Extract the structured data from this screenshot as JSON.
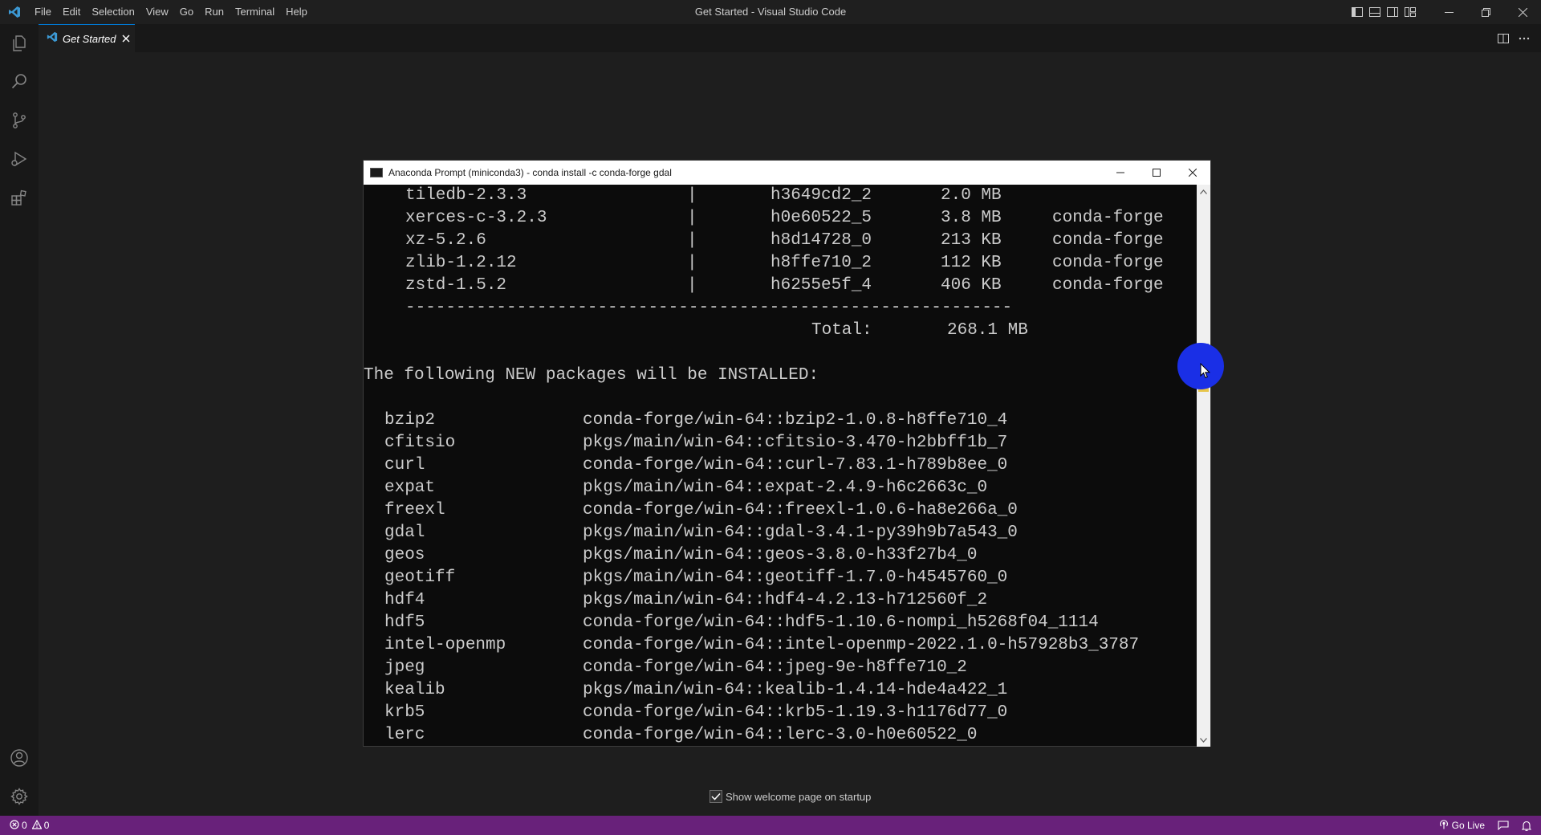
{
  "window": {
    "title": "Get Started - Visual Studio Code"
  },
  "menu": [
    "File",
    "Edit",
    "Selection",
    "View",
    "Go",
    "Run",
    "Terminal",
    "Help"
  ],
  "activity_icons": [
    "explorer-icon",
    "search-icon",
    "source-control-icon",
    "run-debug-icon",
    "extensions-icon",
    "account-icon",
    "gear-icon"
  ],
  "tab": {
    "label": "Get Started"
  },
  "terminal": {
    "title": "Anaconda Prompt (miniconda3) - conda  install -c conda-forge gdal",
    "table_rows": [
      {
        "name": "tiledb-2.3.3",
        "sep": "|",
        "build": "h3649cd2_2",
        "size": "2.0 MB",
        "channel": ""
      },
      {
        "name": "xerces-c-3.2.3",
        "sep": "|",
        "build": "h0e60522_5",
        "size": "3.8 MB",
        "channel": "conda-forge"
      },
      {
        "name": "xz-5.2.6",
        "sep": "|",
        "build": "h8d14728_0",
        "size": "213 KB",
        "channel": "conda-forge"
      },
      {
        "name": "zlib-1.2.12",
        "sep": "|",
        "build": "h8ffe710_2",
        "size": "112 KB",
        "channel": "conda-forge"
      },
      {
        "name": "zstd-1.5.2",
        "sep": "|",
        "build": "h6255e5f_4",
        "size": "406 KB",
        "channel": "conda-forge"
      }
    ],
    "divider": "------------------------------------------------------------",
    "total_label": "Total:",
    "total_value": "268.1 MB",
    "new_packages_heading": "The following NEW packages will be INSTALLED:",
    "packages": [
      {
        "name": "bzip2",
        "spec": "conda-forge/win-64::bzip2-1.0.8-h8ffe710_4"
      },
      {
        "name": "cfitsio",
        "spec": "pkgs/main/win-64::cfitsio-3.470-h2bbff1b_7"
      },
      {
        "name": "curl",
        "spec": "conda-forge/win-64::curl-7.83.1-h789b8ee_0"
      },
      {
        "name": "expat",
        "spec": "pkgs/main/win-64::expat-2.4.9-h6c2663c_0"
      },
      {
        "name": "freexl",
        "spec": "conda-forge/win-64::freexl-1.0.6-ha8e266a_0"
      },
      {
        "name": "gdal",
        "spec": "pkgs/main/win-64::gdal-3.4.1-py39h9b7a543_0"
      },
      {
        "name": "geos",
        "spec": "pkgs/main/win-64::geos-3.8.0-h33f27b4_0"
      },
      {
        "name": "geotiff",
        "spec": "pkgs/main/win-64::geotiff-1.7.0-h4545760_0"
      },
      {
        "name": "hdf4",
        "spec": "pkgs/main/win-64::hdf4-4.2.13-h712560f_2"
      },
      {
        "name": "hdf5",
        "spec": "conda-forge/win-64::hdf5-1.10.6-nompi_h5268f04_1114"
      },
      {
        "name": "intel-openmp",
        "spec": "conda-forge/win-64::intel-openmp-2022.1.0-h57928b3_3787"
      },
      {
        "name": "jpeg",
        "spec": "conda-forge/win-64::jpeg-9e-h8ffe710_2"
      },
      {
        "name": "kealib",
        "spec": "pkgs/main/win-64::kealib-1.4.14-hde4a422_1"
      },
      {
        "name": "krb5",
        "spec": "conda-forge/win-64::krb5-1.19.3-h1176d77_0"
      },
      {
        "name": "lerc",
        "spec": "conda-forge/win-64::lerc-3.0-h0e60522_0"
      }
    ],
    "scroll_position": 0.3
  },
  "welcome": {
    "checkbox_label": "Show welcome page on startup",
    "checked": true
  },
  "status": {
    "errors": "0",
    "warnings": "0",
    "go_live": "Go Live"
  },
  "colors": {
    "status_bar": "#68217a",
    "accent": "#0078d4",
    "cursor_highlight": "#1a2fe6"
  }
}
